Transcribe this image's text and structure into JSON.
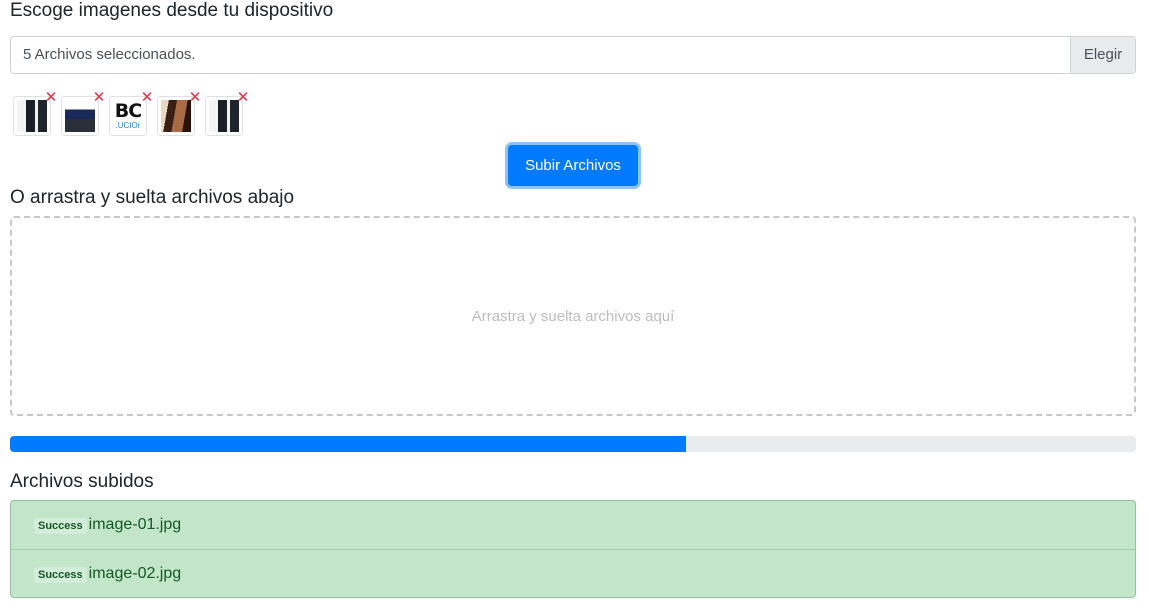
{
  "sections": {
    "choose_heading": "Escoge imagenes desde tu dispositivo",
    "drag_heading": "O arrastra y suelta archivos abajo",
    "uploaded_heading": "Archivos subidos"
  },
  "file_input": {
    "label": "5 Archivos seleccionados.",
    "browse_label": "Elegir"
  },
  "thumbnails": [
    {
      "name": "image-thumbnail-1",
      "remove_icon": "close-icon"
    },
    {
      "name": "image-thumbnail-2",
      "remove_icon": "close-icon"
    },
    {
      "name": "image-thumbnail-3",
      "logo_text": "BC",
      "logo_subtext": ".UCIOr",
      "remove_icon": "close-icon"
    },
    {
      "name": "image-thumbnail-4",
      "remove_icon": "close-icon"
    },
    {
      "name": "image-thumbnail-5",
      "remove_icon": "close-icon"
    }
  ],
  "remove_glyph": "✕",
  "upload_button": "Subir Archivos",
  "dropzone": {
    "placeholder": "Arrastra y suelta archivos aquí"
  },
  "progress": {
    "fraction": 0.6
  },
  "uploaded_files": [
    {
      "status": "Success",
      "filename": "image-01.jpg"
    },
    {
      "status": "Success",
      "filename": "image-02.jpg"
    }
  ],
  "colors": {
    "primary": "#007bff",
    "success_bg": "#c3e6cb",
    "success_text": "#155724",
    "remove": "#dc3545"
  }
}
